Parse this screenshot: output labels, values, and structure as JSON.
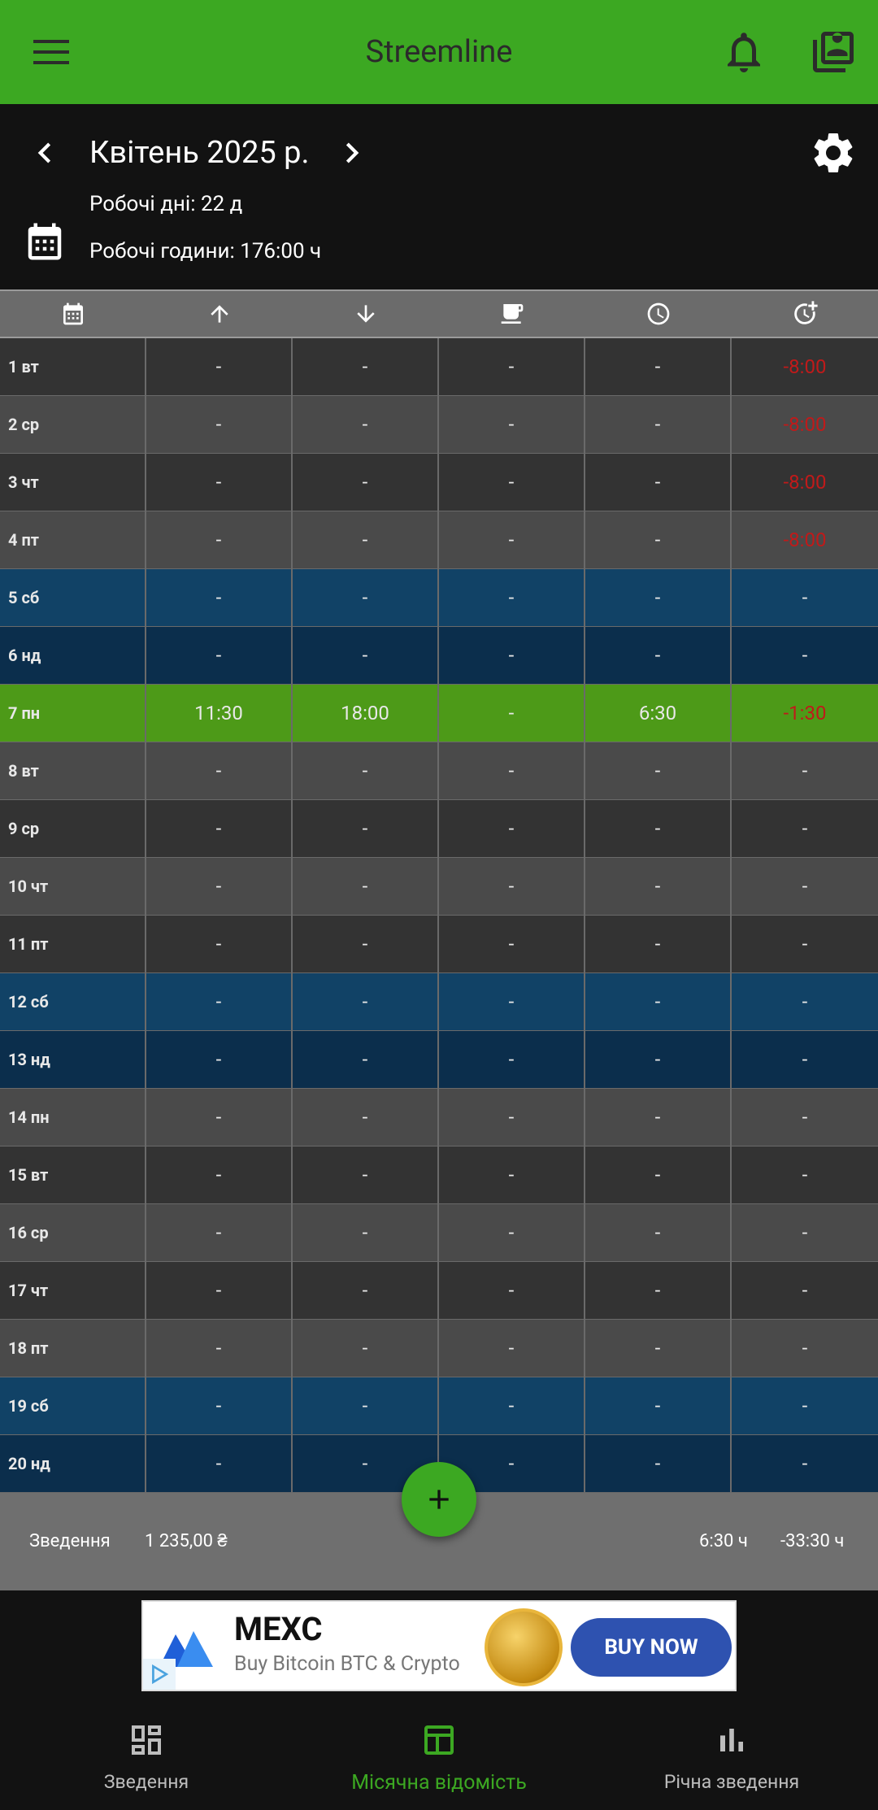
{
  "app": {
    "title": "Streemline"
  },
  "header": {
    "month": "Квітень 2025 р.",
    "working_days": "Робочі дні: 22 д",
    "working_hours": "Робочі години: 176:00 ч"
  },
  "columns": [
    "calendar-icon",
    "arrow-up-icon",
    "arrow-down-icon",
    "coffee-icon",
    "clock-icon",
    "clock-plus-icon"
  ],
  "rows": [
    {
      "day": "1 вт",
      "in": "-",
      "out": "-",
      "break": "-",
      "worked": "-",
      "diff": "-8:00",
      "kind": "workday"
    },
    {
      "day": "2 ср",
      "in": "-",
      "out": "-",
      "break": "-",
      "worked": "-",
      "diff": "-8:00",
      "kind": "workday"
    },
    {
      "day": "3 чт",
      "in": "-",
      "out": "-",
      "break": "-",
      "worked": "-",
      "diff": "-8:00",
      "kind": "workday"
    },
    {
      "day": "4 пт",
      "in": "-",
      "out": "-",
      "break": "-",
      "worked": "-",
      "diff": "-8:00",
      "kind": "workday"
    },
    {
      "day": "5 сб",
      "in": "-",
      "out": "-",
      "break": "-",
      "worked": "-",
      "diff": "-",
      "kind": "saturday"
    },
    {
      "day": "6 нд",
      "in": "-",
      "out": "-",
      "break": "-",
      "worked": "-",
      "diff": "-",
      "kind": "sunday"
    },
    {
      "day": "7 пн",
      "in": "11:30",
      "out": "18:00",
      "break": "-",
      "worked": "6:30",
      "diff": "-1:30",
      "kind": "today"
    },
    {
      "day": "8 вт",
      "in": "-",
      "out": "-",
      "break": "-",
      "worked": "-",
      "diff": "-",
      "kind": "workday"
    },
    {
      "day": "9 ср",
      "in": "-",
      "out": "-",
      "break": "-",
      "worked": "-",
      "diff": "-",
      "kind": "workday"
    },
    {
      "day": "10 чт",
      "in": "-",
      "out": "-",
      "break": "-",
      "worked": "-",
      "diff": "-",
      "kind": "workday"
    },
    {
      "day": "11 пт",
      "in": "-",
      "out": "-",
      "break": "-",
      "worked": "-",
      "diff": "-",
      "kind": "workday"
    },
    {
      "day": "12 сб",
      "in": "-",
      "out": "-",
      "break": "-",
      "worked": "-",
      "diff": "-",
      "kind": "saturday"
    },
    {
      "day": "13 нд",
      "in": "-",
      "out": "-",
      "break": "-",
      "worked": "-",
      "diff": "-",
      "kind": "sunday"
    },
    {
      "day": "14 пн",
      "in": "-",
      "out": "-",
      "break": "-",
      "worked": "-",
      "diff": "-",
      "kind": "workday"
    },
    {
      "day": "15 вт",
      "in": "-",
      "out": "-",
      "break": "-",
      "worked": "-",
      "diff": "-",
      "kind": "workday"
    },
    {
      "day": "16 ср",
      "in": "-",
      "out": "-",
      "break": "-",
      "worked": "-",
      "diff": "-",
      "kind": "workday"
    },
    {
      "day": "17 чт",
      "in": "-",
      "out": "-",
      "break": "-",
      "worked": "-",
      "diff": "-",
      "kind": "workday"
    },
    {
      "day": "18 пт",
      "in": "-",
      "out": "-",
      "break": "-",
      "worked": "-",
      "diff": "-",
      "kind": "workday"
    },
    {
      "day": "19 сб",
      "in": "-",
      "out": "-",
      "break": "-",
      "worked": "-",
      "diff": "-",
      "kind": "saturday"
    },
    {
      "day": "20 нд",
      "in": "-",
      "out": "-",
      "break": "-",
      "worked": "-",
      "diff": "-",
      "kind": "sunday"
    }
  ],
  "summary": {
    "label": "Зведення",
    "amount": "1 235,00 ₴",
    "worked": "6:30 ч",
    "diff": "-33:30 ч"
  },
  "ad": {
    "brand": "MEXC",
    "tagline": "Buy Bitcoin BTC & Crypto",
    "cta": "BUY NOW"
  },
  "nav": [
    {
      "label": "Зведення",
      "icon": "dashboard-icon",
      "active": false
    },
    {
      "label": "Місячна відомість",
      "icon": "table-icon",
      "active": true
    },
    {
      "label": "Річна зведення",
      "icon": "bar-chart-icon",
      "active": false
    }
  ],
  "colors": {
    "accent": "#3ca822",
    "row_dark": "#333333",
    "row_light": "#4a4a4a",
    "saturday": "#114266",
    "sunday": "#0b2e4c",
    "today": "#4d9a18",
    "negative": "#c01a1a"
  }
}
